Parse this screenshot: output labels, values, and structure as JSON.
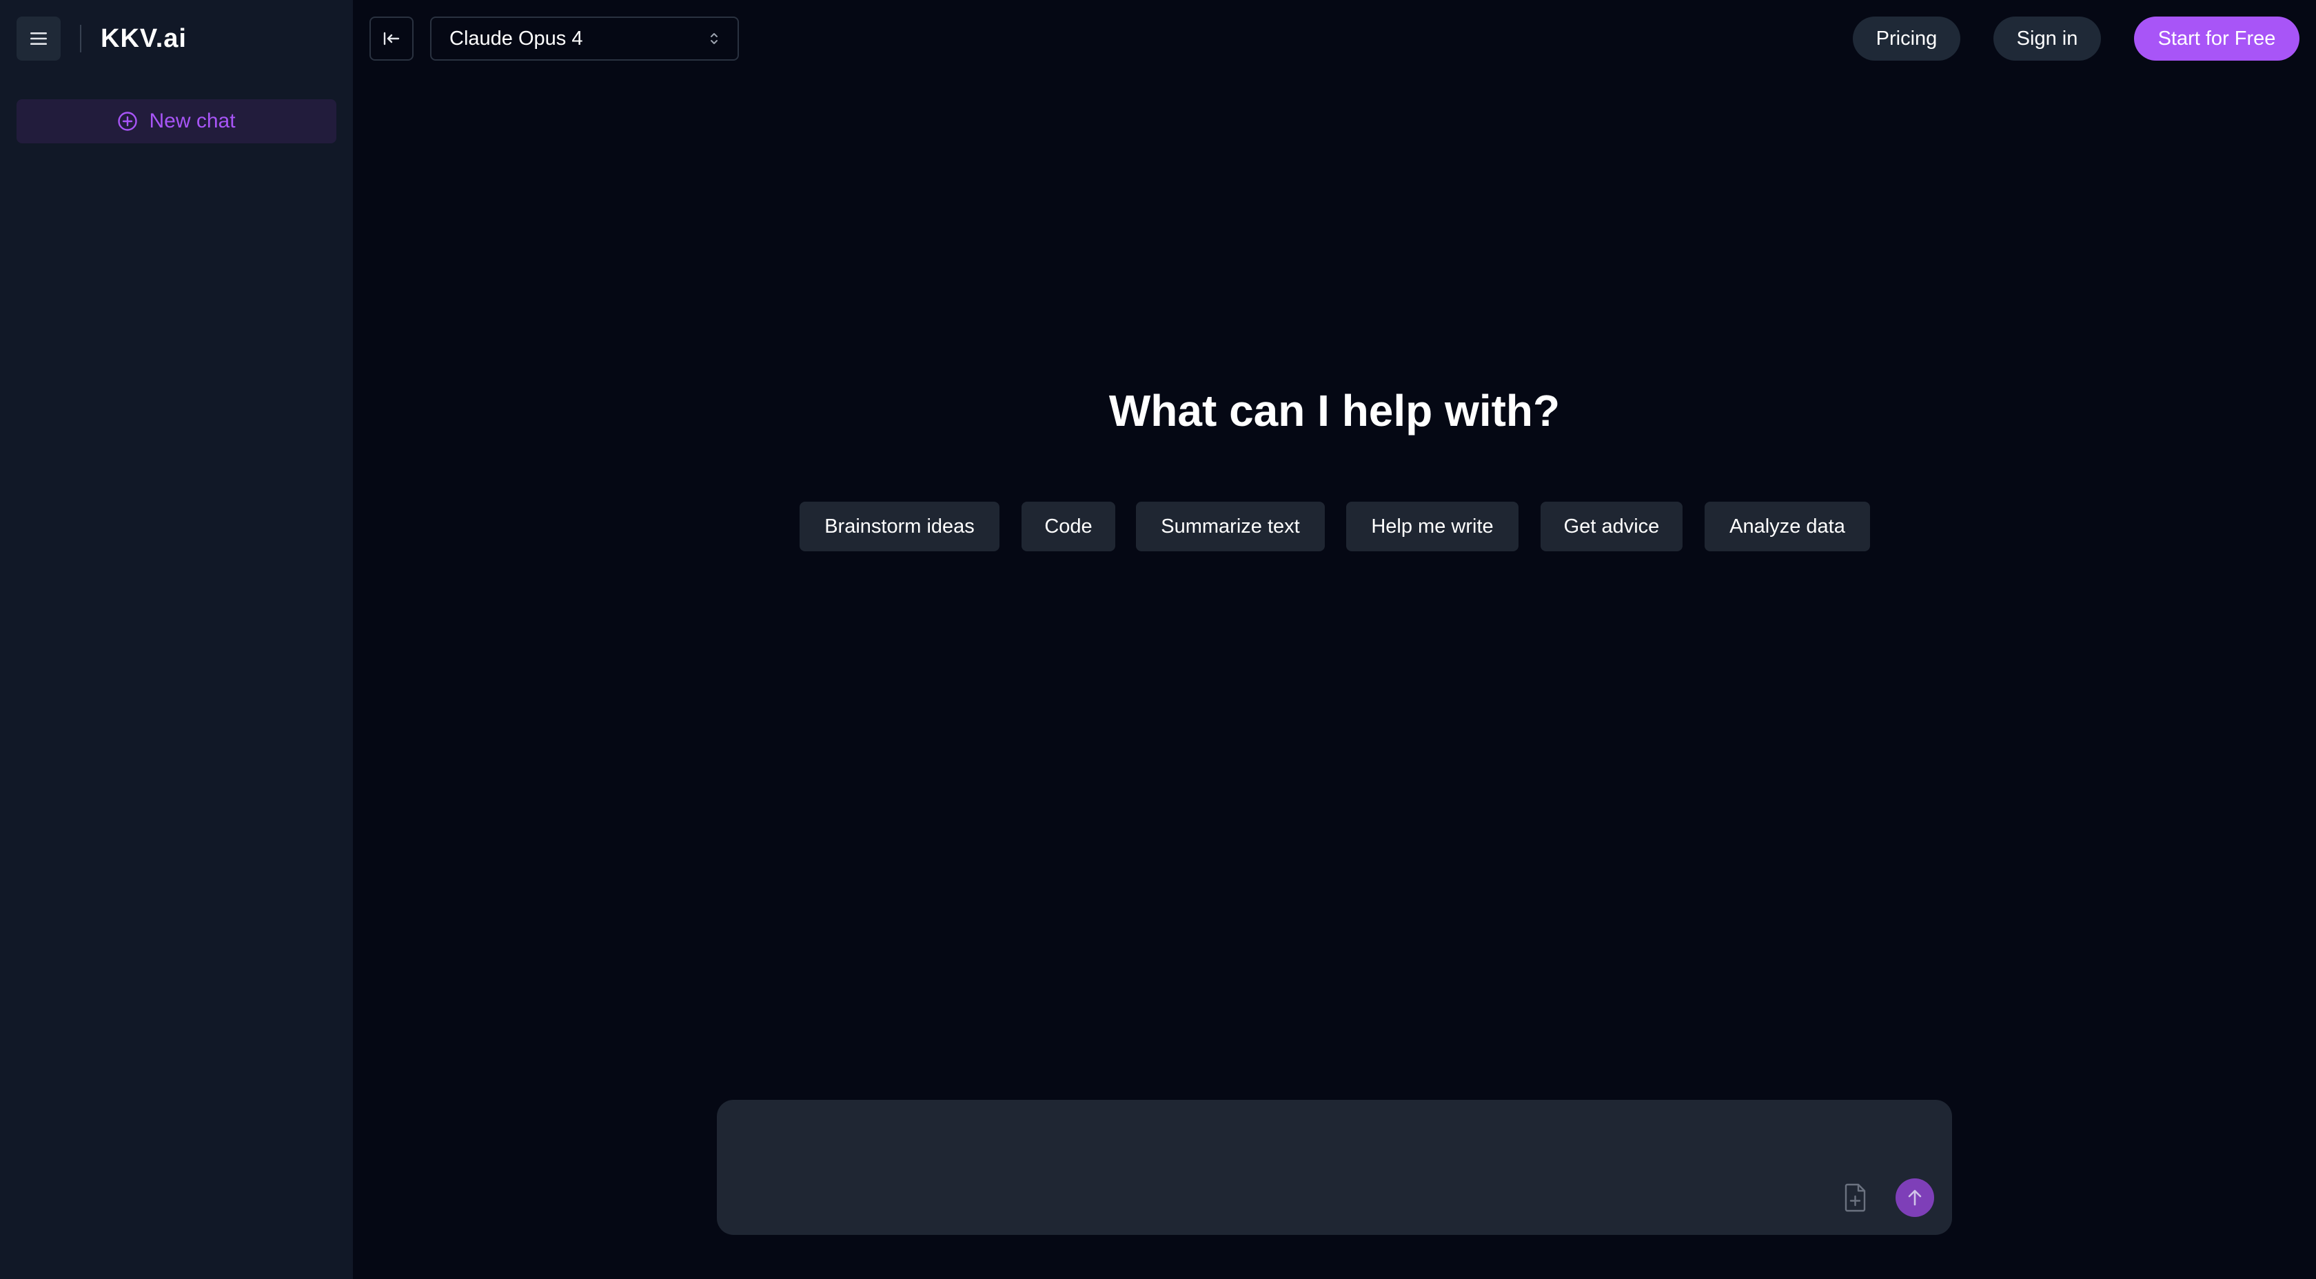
{
  "sidebar": {
    "menu_icon": "hamburger-menu-icon",
    "logo": "KKV.ai",
    "new_chat_label": "New chat",
    "new_chat_icon": "plus-circle-icon"
  },
  "header": {
    "collapse_icon": "collapse-sidebar-icon",
    "model_selected": "Claude Opus 4",
    "model_chevron_icon": "chevron-up-down-icon",
    "pricing_label": "Pricing",
    "signin_label": "Sign in",
    "start_label": "Start for Free"
  },
  "main": {
    "headline": "What can I help with?",
    "suggestions": [
      "Brainstorm ideas",
      "Code",
      "Summarize text",
      "Help me write",
      "Get advice",
      "Analyze data"
    ]
  },
  "composer": {
    "placeholder": "",
    "attach_icon": "file-plus-icon",
    "send_icon": "arrow-up-icon"
  },
  "colors": {
    "background": "#050814",
    "sidebar": "#111827",
    "accent": "#a855f7",
    "send_button": "#7e3fb8",
    "pill": "#1f2937"
  }
}
